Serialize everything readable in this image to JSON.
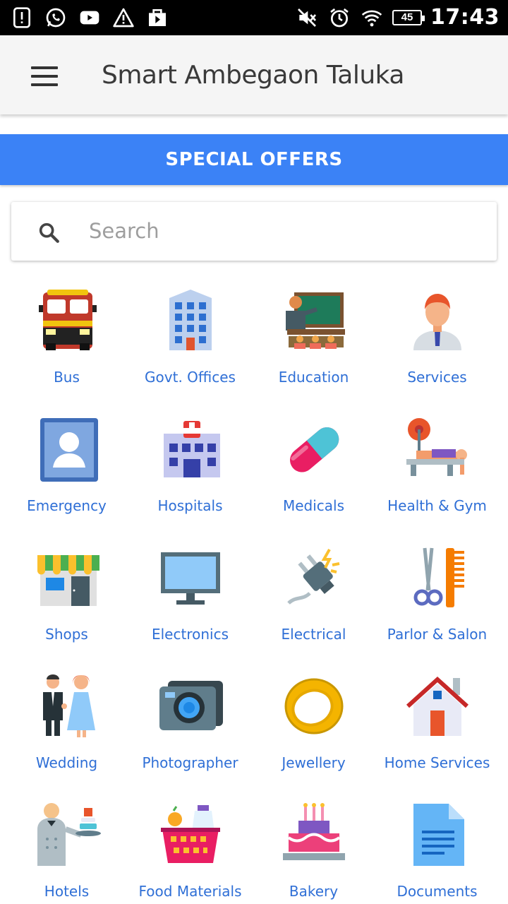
{
  "status_bar": {
    "time": "17:43",
    "battery": "45",
    "left_icons": [
      "alert-icon",
      "whatsapp-icon",
      "youtube-icon",
      "warning-icon",
      "play-store-icon"
    ],
    "right_icons": [
      "mute-icon",
      "alarm-icon",
      "wifi-icon"
    ]
  },
  "app_bar": {
    "title": "Smart Ambegaon Taluka",
    "menu_icon": "hamburger-menu-icon"
  },
  "offers": {
    "label": "SPECIAL OFFERS",
    "color": "#3b82f6"
  },
  "search": {
    "placeholder": "Search",
    "value": ""
  },
  "categories": [
    {
      "label": "Bus",
      "icon": "bus-icon"
    },
    {
      "label": "Govt. Offices",
      "icon": "office-building-icon"
    },
    {
      "label": "Education",
      "icon": "classroom-icon"
    },
    {
      "label": "Services",
      "icon": "service-person-icon"
    },
    {
      "label": "Emergency",
      "icon": "contact-book-icon"
    },
    {
      "label": "Hospitals",
      "icon": "hospital-icon"
    },
    {
      "label": "Medicals",
      "icon": "pill-capsule-icon"
    },
    {
      "label": "Health & Gym",
      "icon": "bench-press-icon"
    },
    {
      "label": "Shops",
      "icon": "shop-icon"
    },
    {
      "label": "Electronics",
      "icon": "monitor-icon"
    },
    {
      "label": "Electrical",
      "icon": "electric-plug-icon"
    },
    {
      "label": "Parlor & Salon",
      "icon": "scissors-comb-icon"
    },
    {
      "label": "Wedding",
      "icon": "wedding-couple-icon"
    },
    {
      "label": "Photographer",
      "icon": "camera-icon"
    },
    {
      "label": "Jewellery",
      "icon": "ring-icon"
    },
    {
      "label": "Home Services",
      "icon": "house-icon"
    },
    {
      "label": "Hotels",
      "icon": "waiter-icon"
    },
    {
      "label": "Food Materials",
      "icon": "grocery-basket-icon"
    },
    {
      "label": "Bakery",
      "icon": "birthday-cake-icon"
    },
    {
      "label": "Documents",
      "icon": "document-icon"
    }
  ],
  "label_color": "#2f6fd6"
}
